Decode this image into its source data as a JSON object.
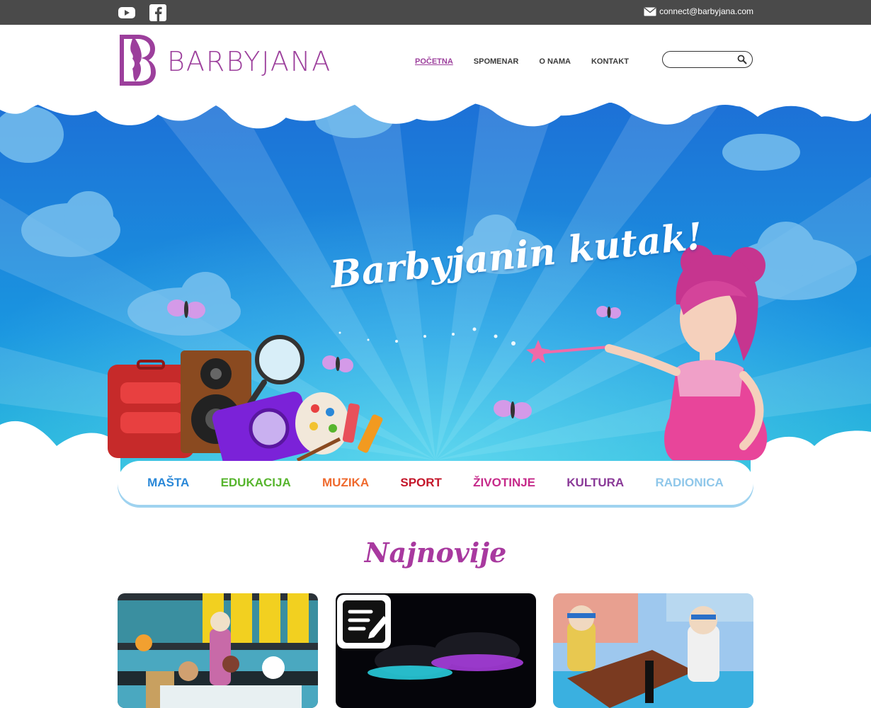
{
  "topbar": {
    "social": [
      {
        "icon": "youtube-icon"
      },
      {
        "icon": "facebook-icon"
      }
    ],
    "email_icon": "envelope-icon",
    "email": "connect@barbyjana.com"
  },
  "header": {
    "logo_text": "BARBYJANA",
    "nav": [
      {
        "label": "POČETNA",
        "active": true
      },
      {
        "label": "SPOMENAR",
        "active": false
      },
      {
        "label": "O NAMA",
        "active": false
      },
      {
        "label": "KONTAKT",
        "active": false
      }
    ],
    "search": {
      "placeholder": "",
      "value": "",
      "icon": "search-icon"
    }
  },
  "hero": {
    "title": "Barbyjanin kutak!"
  },
  "categories": [
    {
      "label": "MAŠTA",
      "color": "#2a88d8"
    },
    {
      "label": "EDUKACIJA",
      "color": "#57b52e"
    },
    {
      "label": "MUZIKA",
      "color": "#ef6a2e"
    },
    {
      "label": "SPORT",
      "color": "#c4162a"
    },
    {
      "label": "ŽIVOTINJE",
      "color": "#c62a8a"
    },
    {
      "label": "KULTURA",
      "color": "#8a3a98"
    },
    {
      "label": "RADIONICA",
      "color": "#8fc7ea"
    }
  ],
  "latest": {
    "title": "Najnovije",
    "cards": [
      {
        "icon": "dolls-photo"
      },
      {
        "icon": "article-icon"
      },
      {
        "icon": "dolls-photo"
      }
    ]
  },
  "colors": {
    "brand": "#9c3f9c",
    "topbar": "#4a4a4a",
    "sky_top": "#1d6fd6",
    "sky_bottom": "#24c6d6"
  }
}
